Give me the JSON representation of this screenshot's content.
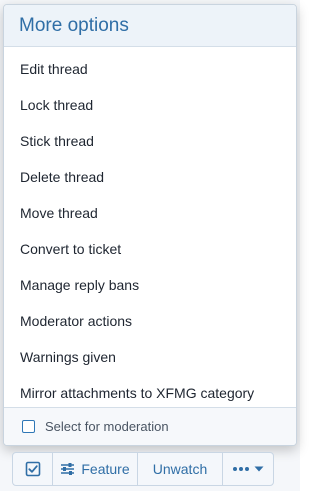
{
  "menu": {
    "title": "More options",
    "items": [
      {
        "label": "Edit thread"
      },
      {
        "label": "Lock thread"
      },
      {
        "label": "Stick thread"
      },
      {
        "label": "Delete thread"
      },
      {
        "label": "Move thread"
      },
      {
        "label": "Convert to ticket"
      },
      {
        "label": "Manage reply bans"
      },
      {
        "label": "Moderator actions"
      },
      {
        "label": "Warnings given"
      },
      {
        "label": "Mirror attachments to XFMG category"
      }
    ],
    "footer": {
      "label": "Select for moderation",
      "checked": false
    }
  },
  "toolbar": {
    "check_icon": "checkbox-checked-icon",
    "feature_icon": "sliders-icon",
    "feature_label": "Feature",
    "unwatch_label": "Unwatch",
    "more_icon": "ellipsis-icon",
    "more_caret_icon": "caret-down-icon"
  },
  "colors": {
    "accent": "#2f6ea6",
    "header_bg": "#edf3f9",
    "text": "#1e2530",
    "border": "#c9d4df"
  }
}
